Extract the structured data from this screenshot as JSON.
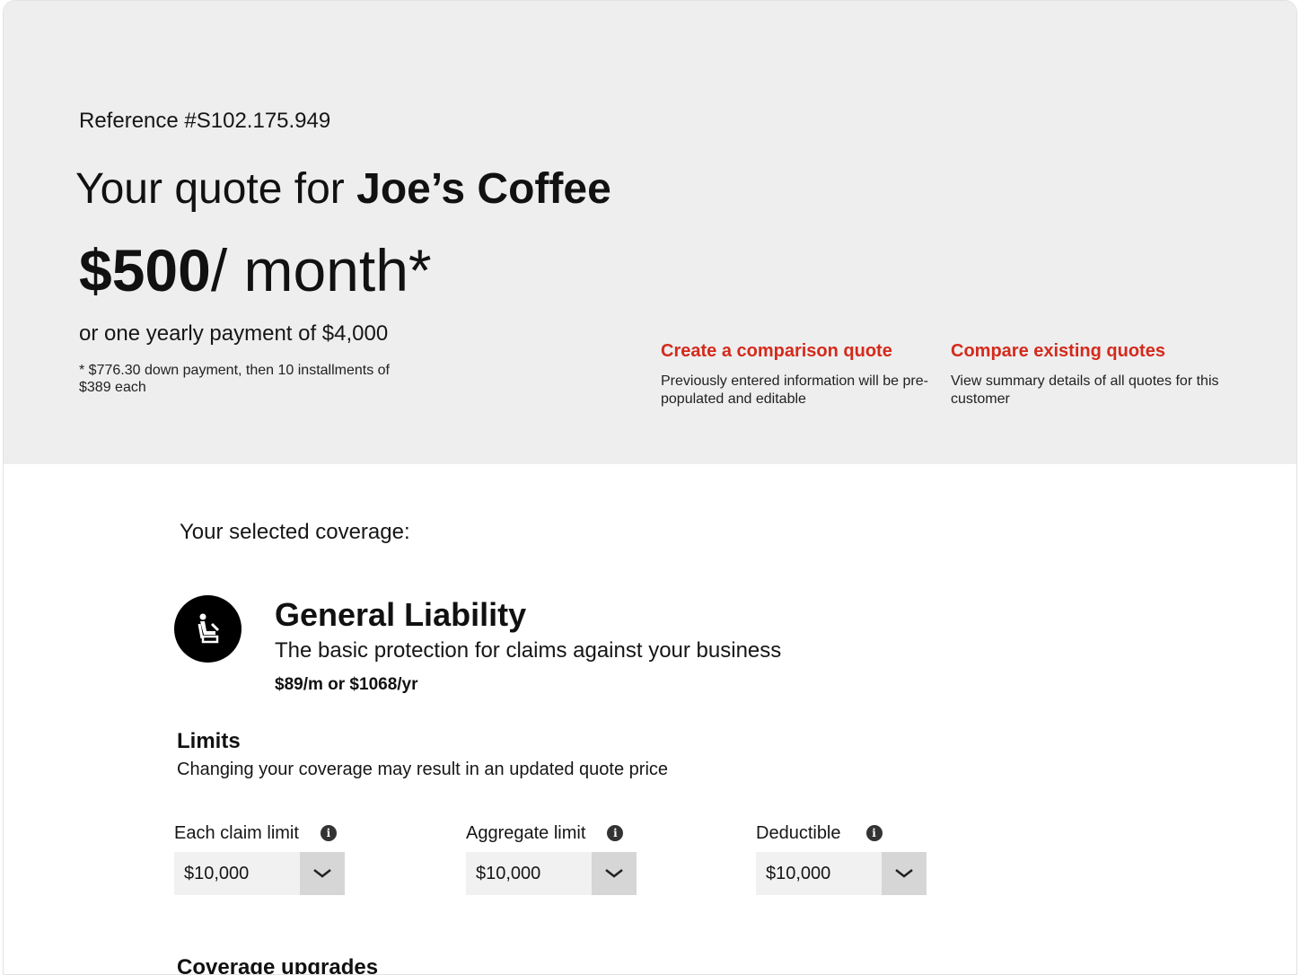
{
  "header": {
    "reference": "Reference #S102.175.949",
    "title_prefix": "Your quote for ",
    "business_name": "Joe’s Coffee",
    "price_amount": "$500",
    "price_period": "/ month*",
    "yearly": "or one yearly payment of $4,000",
    "footnote": "* $776.30 down payment, then 10 installments of $389 each"
  },
  "actions": [
    {
      "label": "Create a comparison quote",
      "description": "Previously entered information will be pre-populated and editable"
    },
    {
      "label": "Compare existing quotes",
      "description": "View summary details of all quotes for this customer"
    }
  ],
  "accent_color": "#d42a1c",
  "coverage": {
    "heading": "Your selected coverage:",
    "icon": "general-liability-icon",
    "name": "General Liability",
    "description": "The basic protection for claims against your business",
    "price": "$89/m or $1068/yr"
  },
  "limits": {
    "heading": "Limits",
    "subtitle": "Changing your coverage may result in an updated quote price",
    "fields": [
      {
        "label": "Each claim limit",
        "value": "$10,000"
      },
      {
        "label": "Aggregate limit",
        "value": "$10,000"
      },
      {
        "label": "Deductible",
        "value": "$10,000"
      }
    ]
  },
  "upgrades_heading": "Coverage upgrades"
}
